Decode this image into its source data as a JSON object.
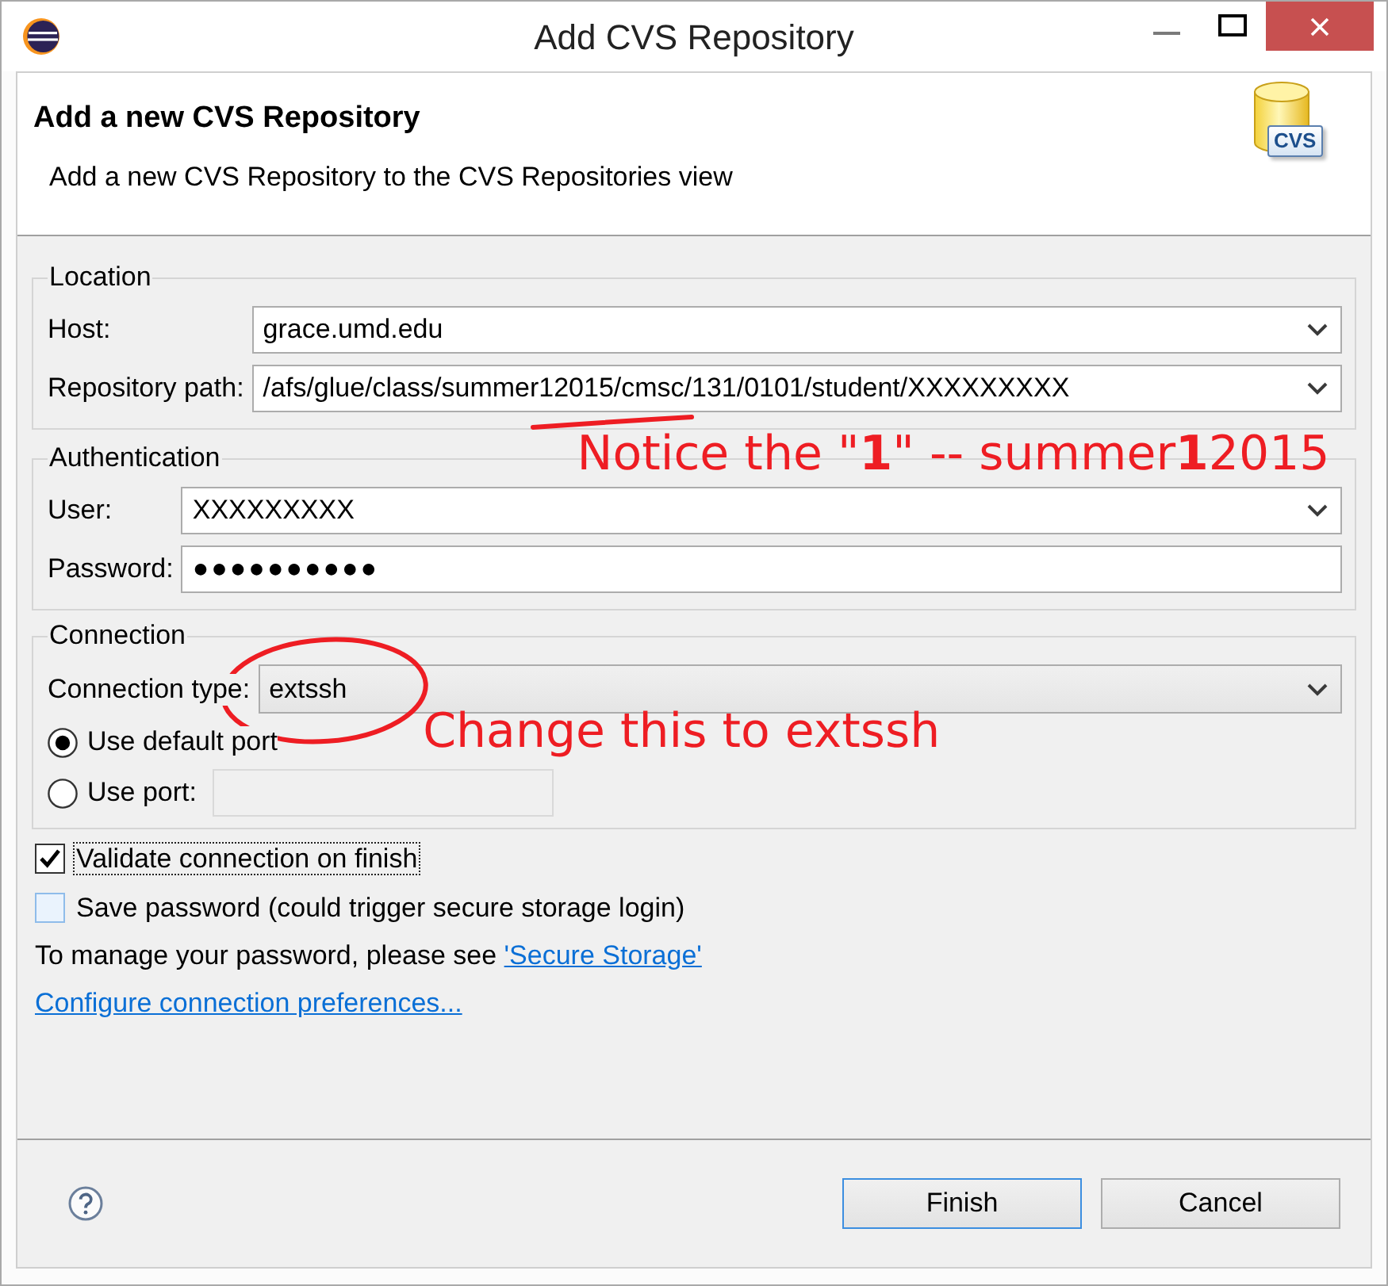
{
  "window": {
    "title": "Add CVS Repository"
  },
  "header": {
    "title": "Add a new CVS Repository",
    "description": "Add a new CVS Repository to the CVS Repositories view",
    "icon_badge": "CVS"
  },
  "groups": [
    {
      "title": "Location",
      "fields": [
        {
          "kind": "combo",
          "label": "Host:",
          "value": "grace.umd.edu"
        },
        {
          "kind": "combo",
          "label": "Repository path:",
          "value": "/afs/glue/class/summer12015/cmsc/131/0101/student/XXXXXXXXX",
          "annotation": {
            "kind": "underline",
            "note": "Notice the \"**1**\" -- summer**1**2015"
          }
        }
      ]
    },
    {
      "title": "Authentication",
      "fields": [
        {
          "kind": "combo",
          "label": "User:",
          "value": "XXXXXXXXX"
        },
        {
          "kind": "password",
          "label": "Password:",
          "value": "●●●●●●●●●●"
        }
      ]
    },
    {
      "title": "Connection",
      "fields": [
        {
          "kind": "readonly_combo",
          "label": "Connection type:",
          "value": "extssh",
          "annotation": {
            "kind": "ellipse",
            "note": "Change this to extssh"
          }
        },
        {
          "kind": "radio",
          "label": "Use default port",
          "selected": true
        },
        {
          "kind": "radio_field",
          "label": "Use port:",
          "selected": false,
          "disabled": true
        }
      ]
    }
  ],
  "checks": [
    {
      "label": "Validate connection on finish",
      "checked": true,
      "focused": true
    },
    {
      "label": "Save password (could trigger secure storage login)",
      "checked": false,
      "focused": false
    }
  ],
  "storage_note": {
    "text": "To manage your password, please see",
    "link": "'Secure Storage'"
  },
  "preferences_link": "Configure connection preferences...",
  "buttons": [
    {
      "label": "Finish",
      "default": true
    },
    {
      "label": "Cancel",
      "default": false
    }
  ]
}
